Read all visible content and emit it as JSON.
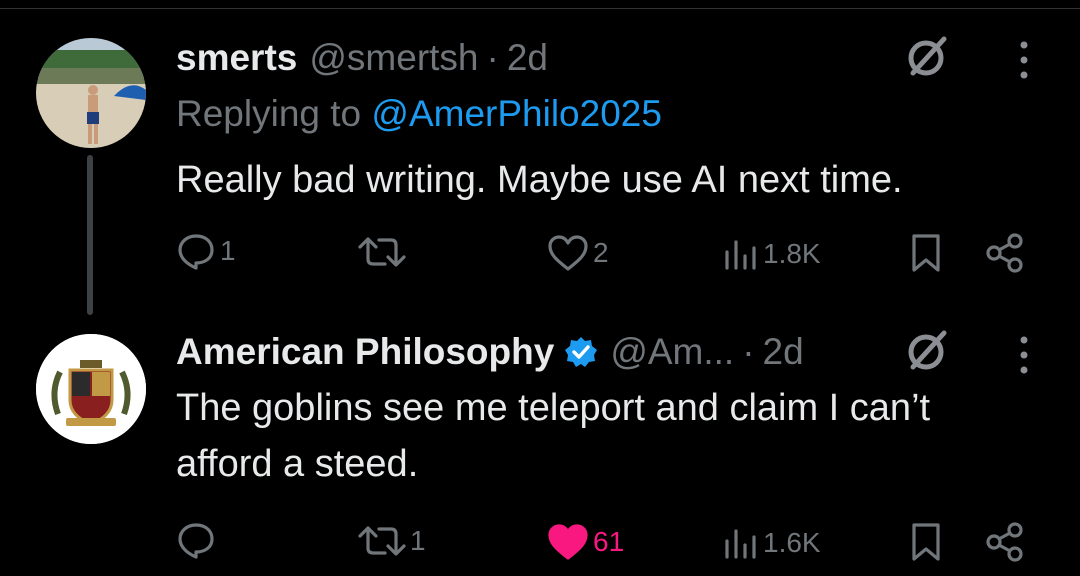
{
  "tweets": [
    {
      "name": "smerts",
      "handle": "@smertsh",
      "dot": "·",
      "time": "2d",
      "replying_prefix": "Replying to",
      "replying_to": "@AmerPhilo2025",
      "text": "Really bad writing. Maybe use AI next time.",
      "replies": "1",
      "reposts": "",
      "likes": "2",
      "views": "1.8K",
      "liked": false,
      "verified": false
    },
    {
      "name": "American Philosophy",
      "handle": "@Am...",
      "dot": "·",
      "time": "2d",
      "text": "The goblins see me teleport and claim I can’t afford a steed.",
      "replies": "",
      "reposts": "1",
      "likes": "61",
      "views": "1.6K",
      "liked": true,
      "verified": true
    }
  ],
  "colors": {
    "background": "#000000",
    "text": "#e7e9ea",
    "muted": "#71767b",
    "link": "#1d9bf0",
    "like": "#f91880",
    "verified": "#1d9bf0"
  },
  "icons": [
    "grok-icon",
    "more-icon",
    "reply-icon",
    "repost-icon",
    "like-icon",
    "views-icon",
    "bookmark-icon",
    "share-icon",
    "verified-badge-icon"
  ]
}
